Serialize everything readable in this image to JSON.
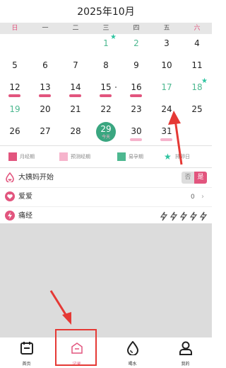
{
  "header": {
    "title": "2025年10月"
  },
  "weekdays": [
    "日",
    "一",
    "二",
    "三",
    "四",
    "五",
    "六"
  ],
  "calendar": {
    "rows": [
      [
        {
          "day": ""
        },
        {
          "day": ""
        },
        {
          "day": ""
        },
        {
          "day": "1",
          "color": "teal",
          "star": true
        },
        {
          "day": "2",
          "color": "teal"
        },
        {
          "day": "3"
        },
        {
          "day": "4"
        }
      ],
      [
        {
          "day": "5"
        },
        {
          "day": "6"
        },
        {
          "day": "7"
        },
        {
          "day": "8"
        },
        {
          "day": "9"
        },
        {
          "day": "10"
        },
        {
          "day": "11"
        }
      ],
      [
        {
          "day": "12",
          "bar": "period"
        },
        {
          "day": "13",
          "bar": "period"
        },
        {
          "day": "14",
          "bar": "period"
        },
        {
          "day": "15",
          "bar": "period",
          "dot": true
        },
        {
          "day": "16",
          "bar": "period"
        },
        {
          "day": "17",
          "color": "teal"
        },
        {
          "day": "18",
          "color": "teal",
          "star": true
        }
      ],
      [
        {
          "day": "19",
          "color": "teal"
        },
        {
          "day": "20"
        },
        {
          "day": "21"
        },
        {
          "day": "22"
        },
        {
          "day": "23"
        },
        {
          "day": "24"
        },
        {
          "day": "25"
        }
      ],
      [
        {
          "day": "26"
        },
        {
          "day": "27"
        },
        {
          "day": "28"
        },
        {
          "day": "29",
          "today": true
        },
        {
          "day": "30",
          "bar": "pred"
        },
        {
          "day": "31",
          "bar": "pred"
        },
        {
          "day": ""
        }
      ]
    ],
    "today_label": "今天"
  },
  "legend": [
    {
      "label": "月经期",
      "color": "#e2557e",
      "shape": "square"
    },
    {
      "label": "预测经期",
      "color": "#f6b4cc",
      "shape": "square"
    },
    {
      "label": "易孕期",
      "color": "#4db890",
      "shape": "square"
    },
    {
      "label": "排卵日",
      "color": "#2ec4a0",
      "shape": "star"
    }
  ],
  "records": {
    "period_start": {
      "label": "大姨妈开始",
      "no": "否",
      "yes": "是"
    },
    "love": {
      "label": "爱爱",
      "count": "0",
      "chevron": "›"
    },
    "cramps": {
      "label": "痛经"
    }
  },
  "tabs": [
    {
      "label": "首页",
      "icon": "calendar-icon"
    },
    {
      "label": "记录",
      "icon": "record-icon",
      "active": true
    },
    {
      "label": "喝水",
      "icon": "drop-icon"
    },
    {
      "label": "我的",
      "icon": "person-icon"
    }
  ],
  "colors": {
    "period": "#e2557e",
    "predicted": "#f6b4cc",
    "fertile": "#4db890",
    "ovulation": "#2ec4a0",
    "highlight": "#e53935"
  }
}
